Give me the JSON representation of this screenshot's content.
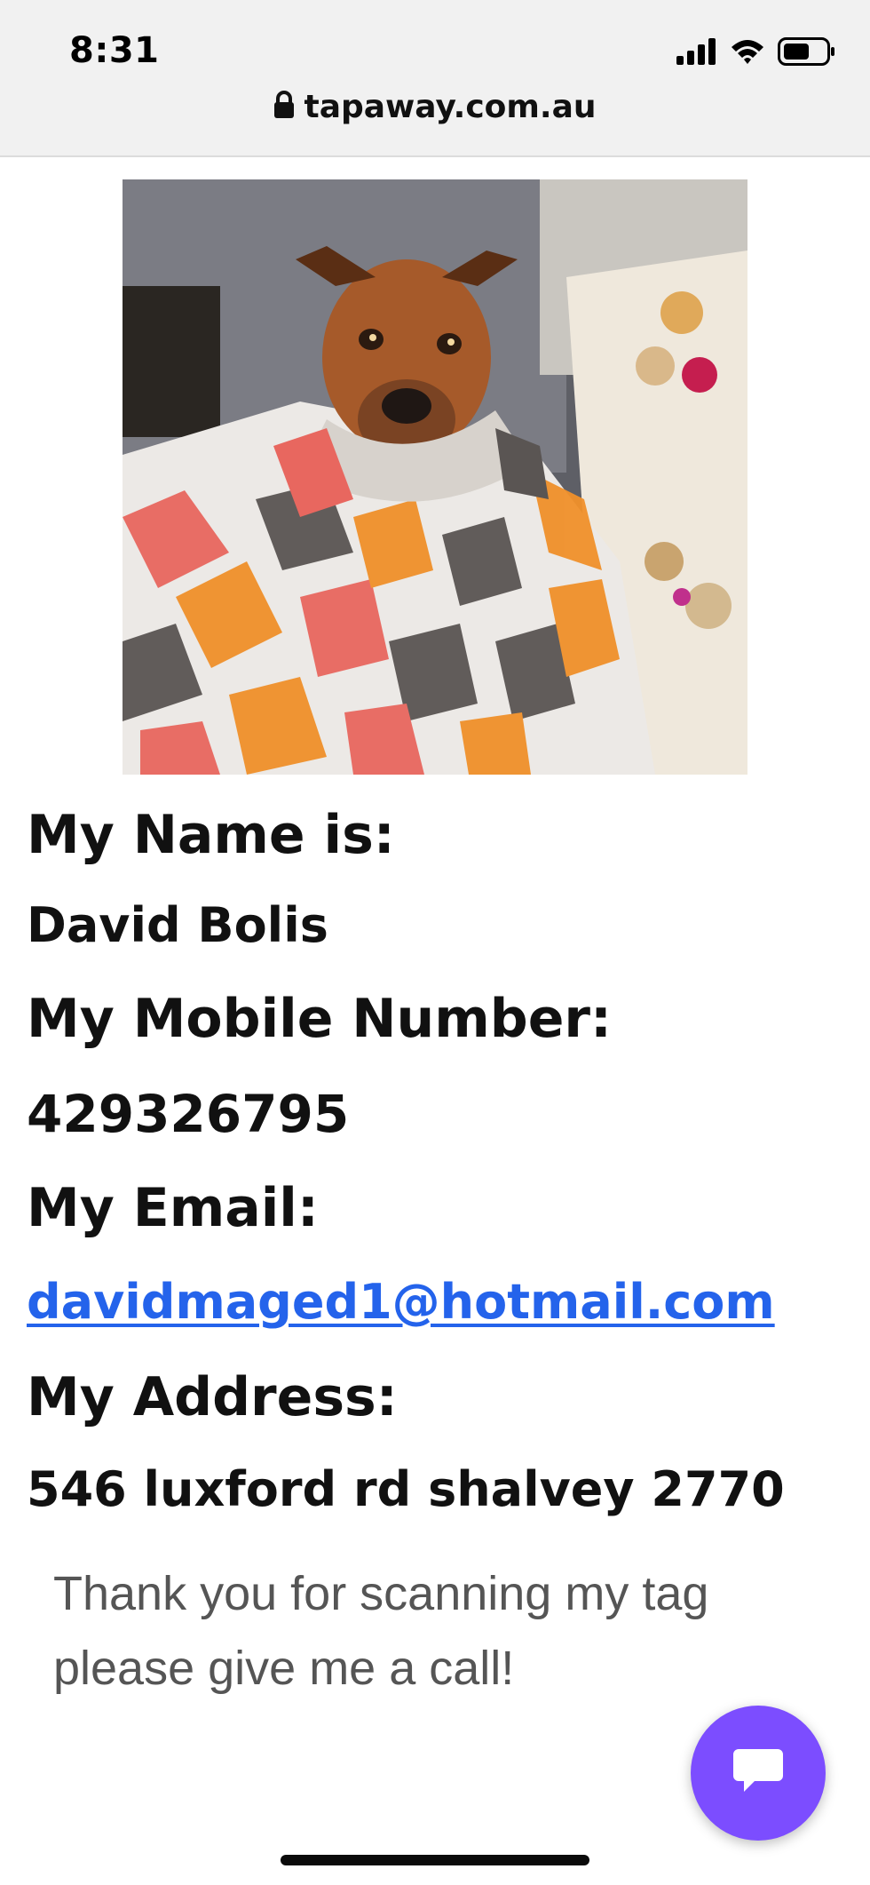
{
  "status_bar": {
    "time": "8:31",
    "icons": [
      "signal-icon",
      "wifi-icon",
      "battery-icon"
    ]
  },
  "address_bar": {
    "url": "tapaway.com.au",
    "icon": "lock-icon"
  },
  "profile": {
    "photo_subject": "pet-photo",
    "name_label": "My Name is:",
    "name_value": "David Bolis",
    "mobile_label": "My Mobile Number:",
    "mobile_value": "429326795",
    "email_label": "My Email:",
    "email_value": "davidmaged1@hotmail.com",
    "address_label": "My Address:",
    "address_value": "546 luxford rd shalvey 2770"
  },
  "message": {
    "line1": "Thank you for scanning my tag",
    "line2": "please give me a call!"
  },
  "chat": {
    "icon": "chat-bubble-icon",
    "color": "#7c4dff"
  },
  "colors": {
    "link": "#2463eb",
    "text": "#111111",
    "muted_text": "#555555"
  }
}
